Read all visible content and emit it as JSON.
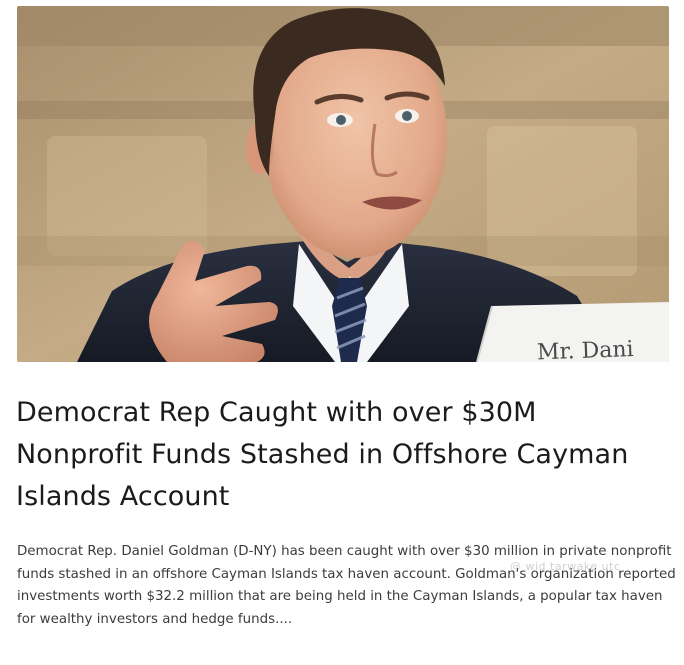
{
  "article": {
    "image_alt": "Man in suit speaking at a hearing",
    "nameplate_text": "Mr. Dani",
    "headline": "Democrat Rep Caught with over $30M Nonprofit Funds Stashed in Offshore Cayman Islands Account",
    "excerpt": "Democrat Rep. Daniel Goldman (D-NY) has been caught with over $30 million in private nonprofit funds stashed in an offshore Cayman Islands tax haven account. Goldman's organization reported investments worth $32.2 million that are being held in the Cayman Islands, a popular tax haven for wealthy investors and hedge funds...."
  },
  "watermark": {
    "text": "@ wid  tarwake    utc"
  },
  "colors": {
    "headline": "#1b1b1b",
    "excerpt": "#3c3c3c",
    "background": "#ffffff"
  }
}
